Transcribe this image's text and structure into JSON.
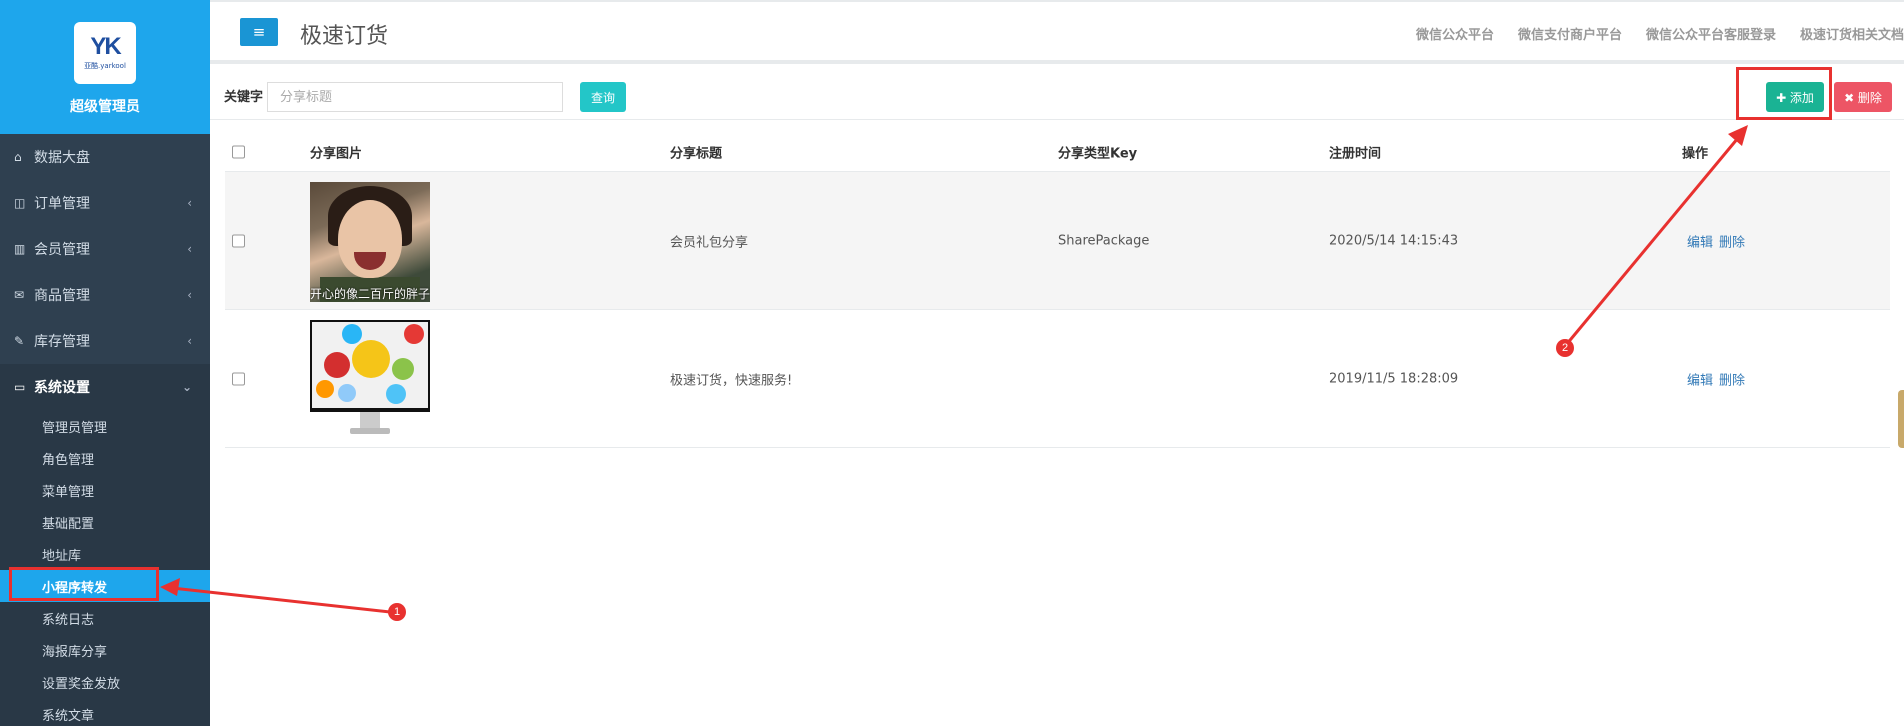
{
  "sidebar": {
    "logo_text": "YK",
    "logo_sub": "亚酷.yarkool",
    "user_role": "超级管理员",
    "items": [
      {
        "label": "数据大盘",
        "icon": "home-icon"
      },
      {
        "label": "订单管理",
        "icon": "columns-icon",
        "chevron": "‹"
      },
      {
        "label": "会员管理",
        "icon": "bar-chart-icon",
        "chevron": "‹"
      },
      {
        "label": "商品管理",
        "icon": "envelope-icon",
        "chevron": "‹"
      },
      {
        "label": "库存管理",
        "icon": "edit-icon",
        "chevron": "‹"
      },
      {
        "label": "系统设置",
        "icon": "desktop-icon",
        "chevron": "⌄"
      }
    ],
    "subitems": [
      "管理员管理",
      "角色管理",
      "菜单管理",
      "基础配置",
      "地址库",
      "小程序转发",
      "系统日志",
      "海报库分享",
      "设置奖金发放",
      "系统文章"
    ]
  },
  "header": {
    "menu_icon": "≡",
    "title": "极速订货",
    "links": [
      "微信公众平台",
      "微信支付商户平台",
      "微信公众平台客服登录",
      "极速订货相关文档"
    ]
  },
  "search": {
    "label": "关键字",
    "placeholder": "分享标题",
    "value": "",
    "query_label": "查询",
    "add_label": "✚ 添加",
    "delete_label": "✖ 删除"
  },
  "table": {
    "headers": [
      "分享图片",
      "分享标题",
      "分享类型Key",
      "注册时间",
      "操作"
    ],
    "rows": [
      {
        "image_caption": "开心的像二百斤的胖子",
        "title": "会员礼包分享",
        "key": "SharePackage",
        "time": "2020/5/14 14:15:43",
        "edit": "编辑",
        "delete": "删除"
      },
      {
        "image_caption": "",
        "title": "极速订货，快速服务!",
        "key": "",
        "time": "2019/11/5 18:28:09",
        "edit": "编辑",
        "delete": "删除"
      }
    ]
  },
  "annotations": {
    "badge1": "1",
    "badge2": "2",
    "color": "#e8312f"
  }
}
